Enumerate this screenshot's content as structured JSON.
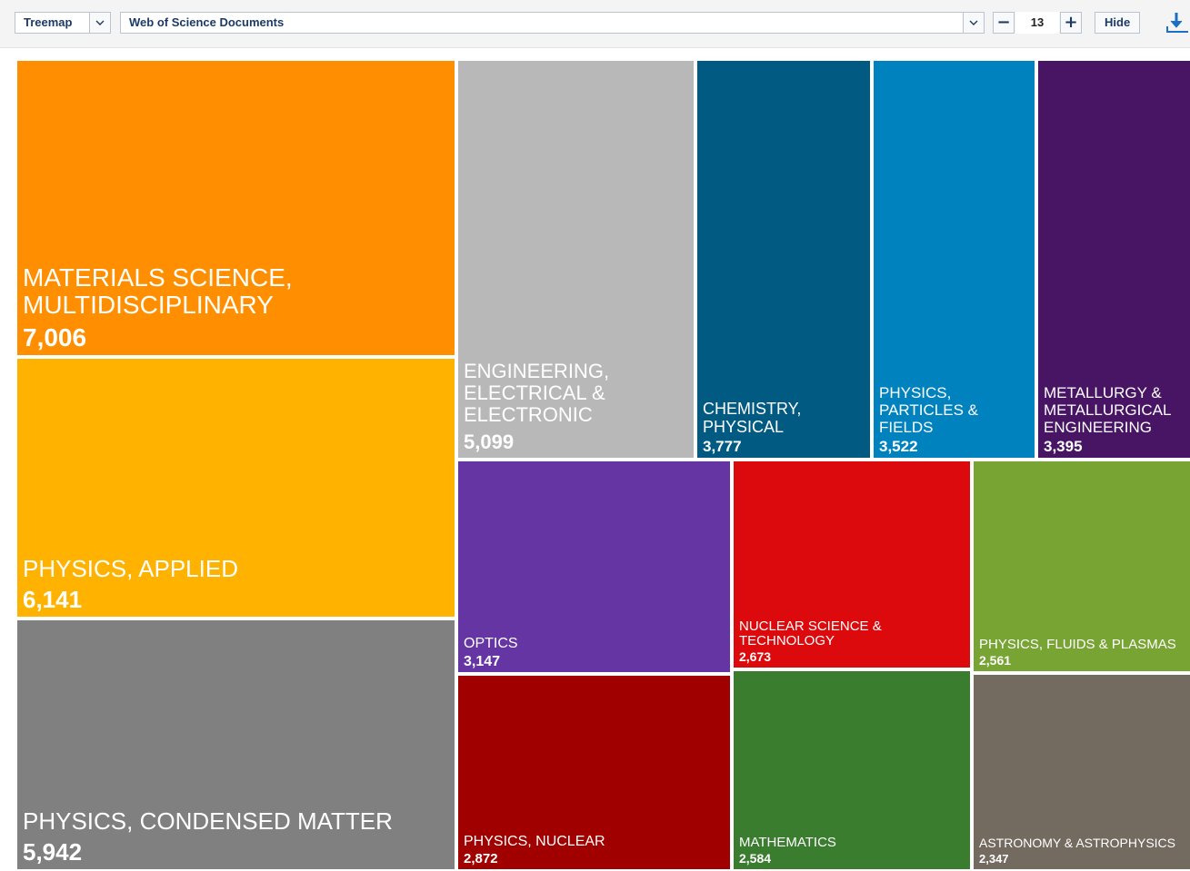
{
  "toolbar": {
    "chart_type": "Treemap",
    "field": "Web of Science Documents",
    "count": "13",
    "decrement_label": "−",
    "increment_label": "+",
    "hide_label": "Hide",
    "download_icon": "download-icon",
    "dropdown_icon": "chevron-down-icon"
  },
  "chart_data": {
    "type": "treemap",
    "title": "",
    "items": [
      {
        "label": "MATERIALS SCIENCE, MULTIDISCIPLINARY",
        "value": 7006,
        "display": "7,006",
        "color": "#FF8F00"
      },
      {
        "label": "PHYSICS, APPLIED",
        "value": 6141,
        "display": "6,141",
        "color": "#FFB300"
      },
      {
        "label": "PHYSICS, CONDENSED MATTER",
        "value": 5942,
        "display": "5,942",
        "color": "#808080"
      },
      {
        "label": "ENGINEERING, ELECTRICAL & ELECTRONIC",
        "value": 5099,
        "display": "5,099",
        "color": "#B8B8B8"
      },
      {
        "label": "CHEMISTRY, PHYSICAL",
        "value": 3777,
        "display": "3,777",
        "color": "#015A82"
      },
      {
        "label": "PHYSICS, PARTICLES & FIELDS",
        "value": 3522,
        "display": "3,522",
        "color": "#0082BF"
      },
      {
        "label": "METALLURGY & METALLURGICAL ENGINEERING",
        "value": 3395,
        "display": "3,395",
        "color": "#481565"
      },
      {
        "label": "OPTICS",
        "value": 3147,
        "display": "3,147",
        "color": "#6535A3"
      },
      {
        "label": "PHYSICS, NUCLEAR",
        "value": 2872,
        "display": "2,872",
        "color": "#A00000"
      },
      {
        "label": "NUCLEAR SCIENCE & TECHNOLOGY",
        "value": 2673,
        "display": "2,673",
        "color": "#DC0A0C"
      },
      {
        "label": "MATHEMATICS",
        "value": 2584,
        "display": "2,584",
        "color": "#3A7D2F"
      },
      {
        "label": "PHYSICS, FLUIDS & PLASMAS",
        "value": 2561,
        "display": "2,561",
        "color": "#78A434"
      },
      {
        "label": "ASTRONOMY & ASTROPHYSICS",
        "value": 2347,
        "display": "2,347",
        "color": "#736A60"
      }
    ]
  }
}
